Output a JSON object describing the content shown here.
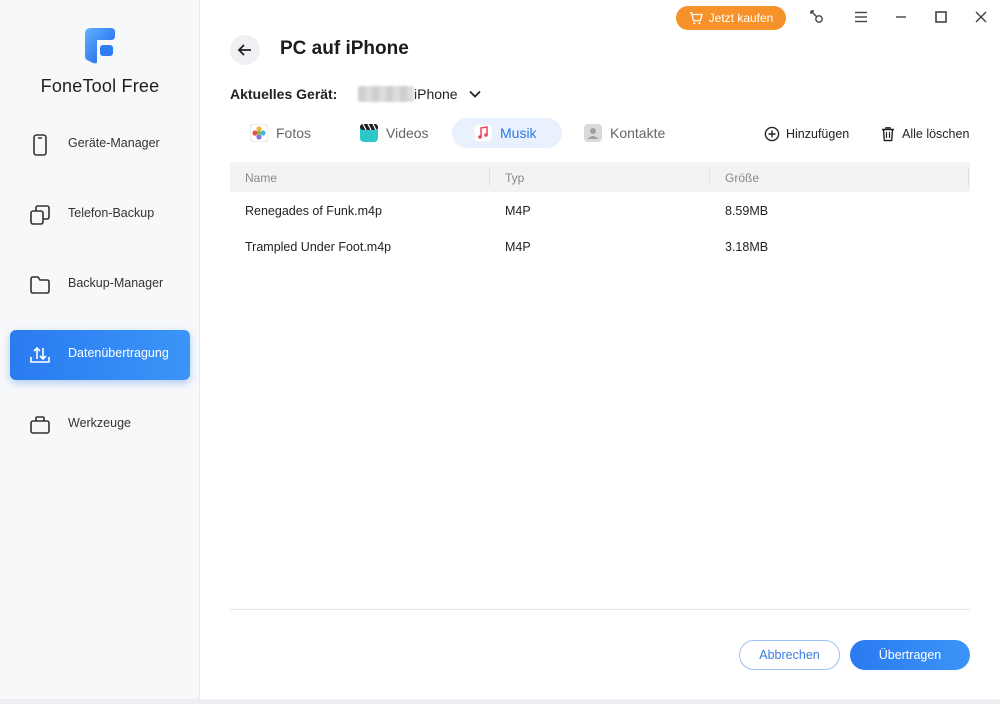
{
  "app": {
    "name": "FoneTool Free"
  },
  "sidebar": {
    "items": [
      {
        "label": "Geräte-Manager",
        "icon": "phone-icon",
        "active": false
      },
      {
        "label": "Telefon-Backup",
        "icon": "copy-icon",
        "active": false
      },
      {
        "label": "Backup-Manager",
        "icon": "folder-icon",
        "active": false
      },
      {
        "label": "Datenübertragung",
        "icon": "transfer-icon",
        "active": true
      },
      {
        "label": "Werkzeuge",
        "icon": "toolbox-icon",
        "active": false
      }
    ]
  },
  "titlebar": {
    "buy_label": "Jetzt kaufen",
    "buy_color": "#f7922a"
  },
  "page": {
    "title": "PC auf iPhone",
    "device_label": "Aktuelles Gerät:",
    "device_name": "iPhone"
  },
  "tabs": [
    {
      "label": "Fotos",
      "icon": "photos-icon",
      "active": false
    },
    {
      "label": "Videos",
      "icon": "videos-icon",
      "active": false
    },
    {
      "label": "Musik",
      "icon": "music-icon",
      "active": true
    },
    {
      "label": "Kontakte",
      "icon": "contacts-icon",
      "active": false
    }
  ],
  "actions": {
    "add_label": "Hinzufügen",
    "delete_all_label": "Alle löschen"
  },
  "table": {
    "columns": [
      "Name",
      "Typ",
      "Größe"
    ],
    "rows": [
      {
        "name": "Renegades of Funk.m4p",
        "type": "M4P",
        "size": "8.59MB"
      },
      {
        "name": "Trampled Under Foot.m4p",
        "type": "M4P",
        "size": "3.18MB"
      }
    ]
  },
  "footer": {
    "cancel_label": "Abbrechen",
    "transfer_label": "Übertragen"
  },
  "colors": {
    "accent": "#2a7bf0",
    "buy": "#f7922a"
  }
}
